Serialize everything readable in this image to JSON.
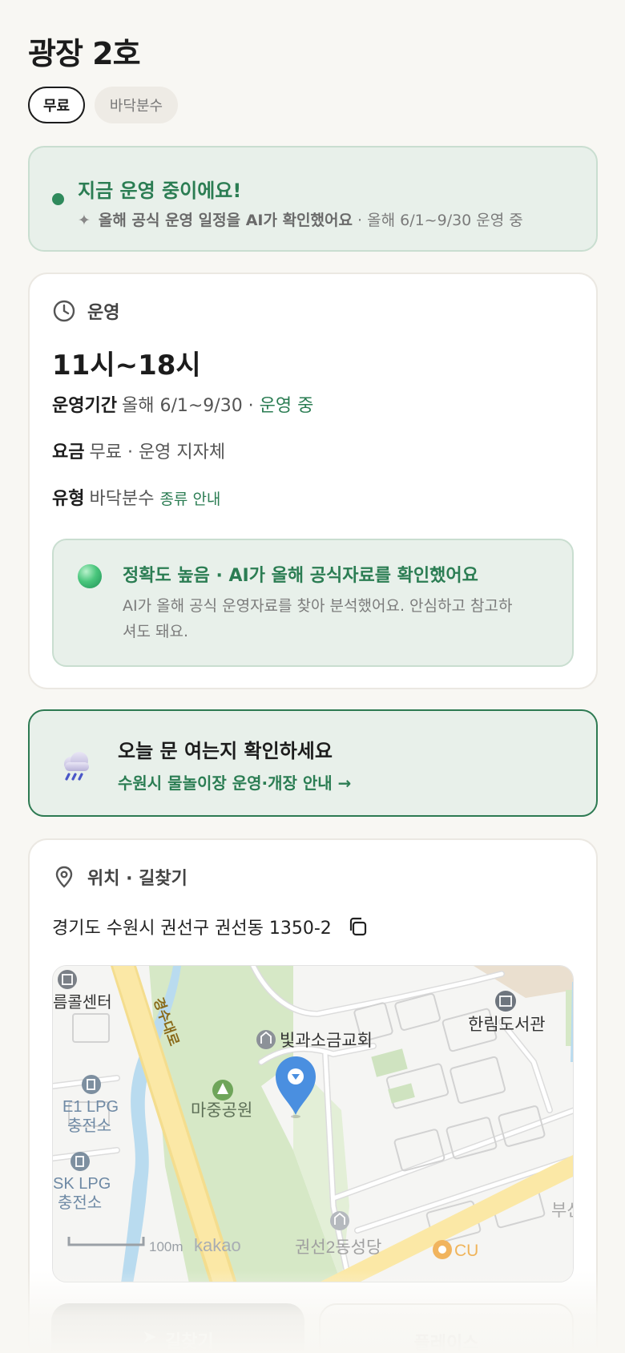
{
  "header": {
    "title": "광장 2호"
  },
  "chips": {
    "selected": "무료",
    "other": "바닥분수"
  },
  "status": {
    "title": "지금 운영 중이에요!",
    "sub_bold": "올해 공식 운영 일정을 AI가 확인했어요",
    "sub_rest": " · 올해 6/1~9/30 운영 중"
  },
  "hours": {
    "heading": "운영",
    "time": "11시~18시",
    "period_label": "운영기간",
    "period_value": "올해 6/1~9/30 ·",
    "period_status": "운영 중",
    "fee_label": "요금",
    "fee_value": "무료 · 운영 지자체",
    "type_label": "유형",
    "type_value": "바닥분수",
    "type_link": "종류 안내"
  },
  "accuracy": {
    "title": "정확도 높음 · AI가 올해 공식자료를 확인했어요",
    "desc": "AI가 올해 공식 운영자료를 찾아 분석했어요. 안심하고 참고하셔도 돼요."
  },
  "notice": {
    "title": "오늘 문 여는지 확인하세요",
    "link": "수원시 물놀이장 운영·개장 안내 →"
  },
  "location": {
    "heading": "위치 · 길찾기",
    "address": "경기도 수원시 권선구 권선동 1350-2"
  },
  "map": {
    "labels": {
      "center": "름콜센터",
      "road": "경수대로",
      "church": "빛과소금교회",
      "library": "한림도서관",
      "park": "마중공원",
      "e1": "E1 LPG",
      "e1_sub": "충전소",
      "sk": "SK LPG",
      "sk_sub": "충전소",
      "cathedral": "권선2동성당",
      "cu": "CU",
      "busan": "부산",
      "scale": "100m",
      "brand": "kakao"
    }
  },
  "actions": {
    "directions": "길찾기",
    "place": "플레이스"
  },
  "colors": {
    "accent": "#2b7d53",
    "card_tint": "#e8f0ea",
    "background": "#f8f7f3"
  }
}
